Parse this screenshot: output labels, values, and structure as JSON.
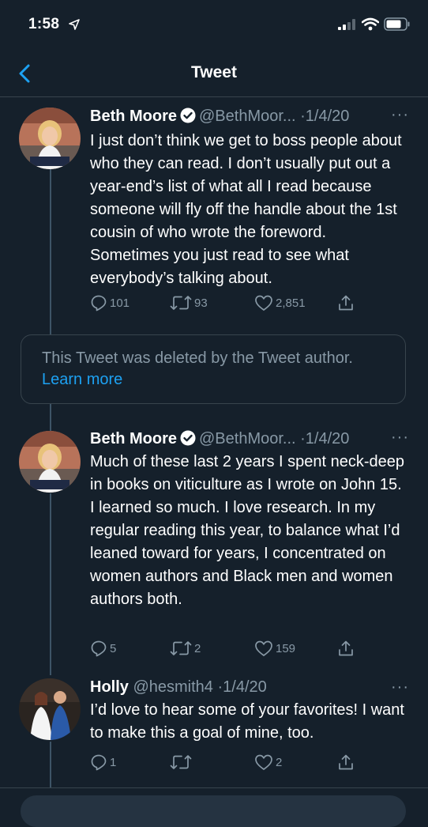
{
  "status_bar": {
    "time": "1:58"
  },
  "nav": {
    "title": "Tweet"
  },
  "tweets": [
    {
      "name": "Beth Moore",
      "handle": "@BethMoor...",
      "date": "·1/4/20",
      "text": "I just don’t think we get to boss people about who they can read. I don’t usually put out a year-end’s list of what all I read because someone will fly off the handle about the 1st cousin of who wrote the foreword. Sometimes you just read to see what everybody’s talking about.",
      "replies": "101",
      "retweets": "93",
      "likes": "2,851"
    },
    {
      "name": "Beth Moore",
      "handle": "@BethMoor...",
      "date": "·1/4/20",
      "text": "Much of these last 2 years I spent neck-deep in books on viticulture as I wrote on John 15. I learned so much. I love research. In my regular reading this year, to balance what I’d leaned toward for years, I concentrated on women authors and Black men and women authors both.",
      "replies": "5",
      "retweets": "2",
      "likes": "159"
    },
    {
      "name": "Holly",
      "handle": "@hesmith4",
      "date": "·1/4/20",
      "text": "I’d love to hear some of your favorites! I want to make this a goal of mine, too.",
      "replies": "1",
      "retweets": "",
      "likes": "2"
    }
  ],
  "deleted_notice": {
    "text": "This Tweet was deleted by the Tweet author.",
    "link": "Learn more"
  },
  "colors": {
    "background": "#15202b",
    "secondary_text": "#8899a6",
    "accent": "#1da1f2",
    "border": "#38444d"
  }
}
